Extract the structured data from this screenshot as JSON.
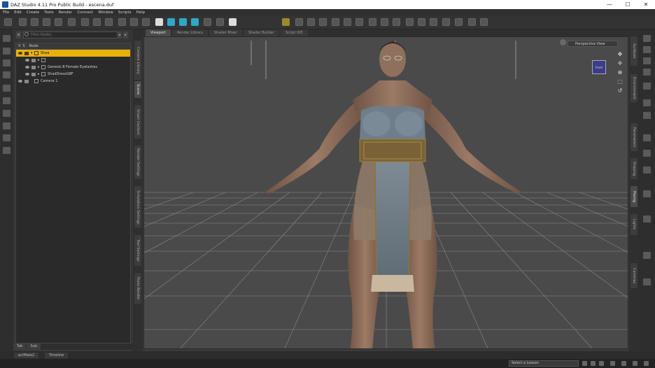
{
  "window": {
    "title": "DAZ Studio 4.11 Pro Public Build - escena.duf",
    "minimize": "—",
    "maximize": "☐",
    "close": "✕"
  },
  "menu": [
    "File",
    "Edit",
    "Create",
    "Tools",
    "Render",
    "Connect",
    "Window",
    "Scripts",
    "Help"
  ],
  "scene_pane": {
    "search_placeholder": "Filter Nodes",
    "columns": [
      "V",
      "S",
      "Node"
    ],
    "nodes": [
      {
        "label": "Shea",
        "selected": true,
        "arrow": "▾"
      },
      {
        "label": "",
        "selected": false,
        "arrow": "▸"
      },
      {
        "label": "Genesis 8 Female Eyelashes",
        "selected": false,
        "arrow": "▸"
      },
      {
        "label": "ShadDressG8F",
        "selected": false,
        "arrow": "▸"
      },
      {
        "label": "Camera 1",
        "selected": false,
        "arrow": ""
      }
    ],
    "bottom_tabs": [
      "Tab",
      "Sub"
    ]
  },
  "left_vertical_tabs": [
    "Content Library",
    "Scene",
    "Smart Content",
    "Render Settings",
    "Simulation Settings",
    "Tool Settings",
    "Posts Render"
  ],
  "viewport_tabs": [
    "Viewport",
    "Render Library",
    "Shader Mixer",
    "Shader Builder",
    "Script IDE"
  ],
  "viewport": {
    "camera_label": "Perspective View",
    "cube_label": "Front"
  },
  "right_vertical_tabs": [
    "Surfaces",
    "Environment",
    "Parameters",
    "Shaping",
    "Posing",
    "Lights",
    "Cameras"
  ],
  "status_tabs": [
    "aniMate2",
    "Timeline"
  ],
  "lesson_select": "Select a Lesson",
  "colors": {
    "selection": "#e8b10a",
    "viewport_bg": "#4a4a4a",
    "accent_teal": "#2fa7c8"
  }
}
